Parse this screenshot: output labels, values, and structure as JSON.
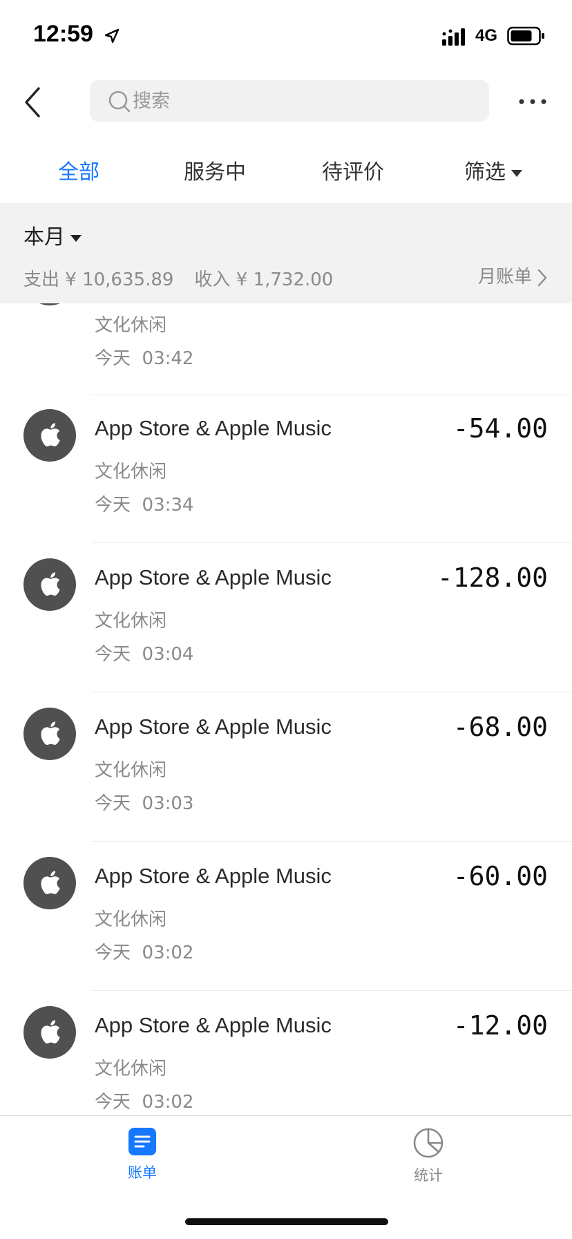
{
  "status_bar": {
    "time": "12:59",
    "network": "4G",
    "icons": [
      "location-arrow-icon",
      "signal-icon",
      "battery-icon"
    ]
  },
  "header": {
    "back_icon": "chevron-left-icon",
    "search_placeholder": "搜索",
    "more_icon": "more-dots-icon"
  },
  "tabs": [
    {
      "label": "全部",
      "active": true
    },
    {
      "label": "服务中",
      "active": false
    },
    {
      "label": "待评价",
      "active": false
    },
    {
      "label": "筛选",
      "active": false
    }
  ],
  "summary": {
    "month_label": "本月",
    "expense_label": "支出",
    "expense_value": "¥ 10,635.89",
    "income_label": "收入",
    "income_value": "¥ 1,732.00",
    "monthly_bill_label": "月账单"
  },
  "transactions": [
    {
      "merchant": "",
      "category": "文化休闲",
      "date": "今天",
      "time": "03:42",
      "amount": ""
    },
    {
      "merchant": "App Store & Apple Music",
      "category": "文化休闲",
      "date": "今天",
      "time": "03:34",
      "amount": "-54.00"
    },
    {
      "merchant": "App Store & Apple Music",
      "category": "文化休闲",
      "date": "今天",
      "time": "03:04",
      "amount": "-128.00"
    },
    {
      "merchant": "App Store & Apple Music",
      "category": "文化休闲",
      "date": "今天",
      "time": "03:03",
      "amount": "-68.00"
    },
    {
      "merchant": "App Store & Apple Music",
      "category": "文化休闲",
      "date": "今天",
      "time": "03:02",
      "amount": "-60.00"
    },
    {
      "merchant": "App Store & Apple Music",
      "category": "文化休闲",
      "date": "今天",
      "time": "03:02",
      "amount": "-12.00"
    }
  ],
  "bottom_nav": [
    {
      "label": "账单",
      "icon": "bill-list-icon",
      "active": true
    },
    {
      "label": "统计",
      "icon": "pie-chart-icon",
      "active": false
    }
  ],
  "colors": {
    "accent": "#1677ff",
    "summary_bg": "#f2f2f2",
    "avatar_bg": "#505050"
  }
}
